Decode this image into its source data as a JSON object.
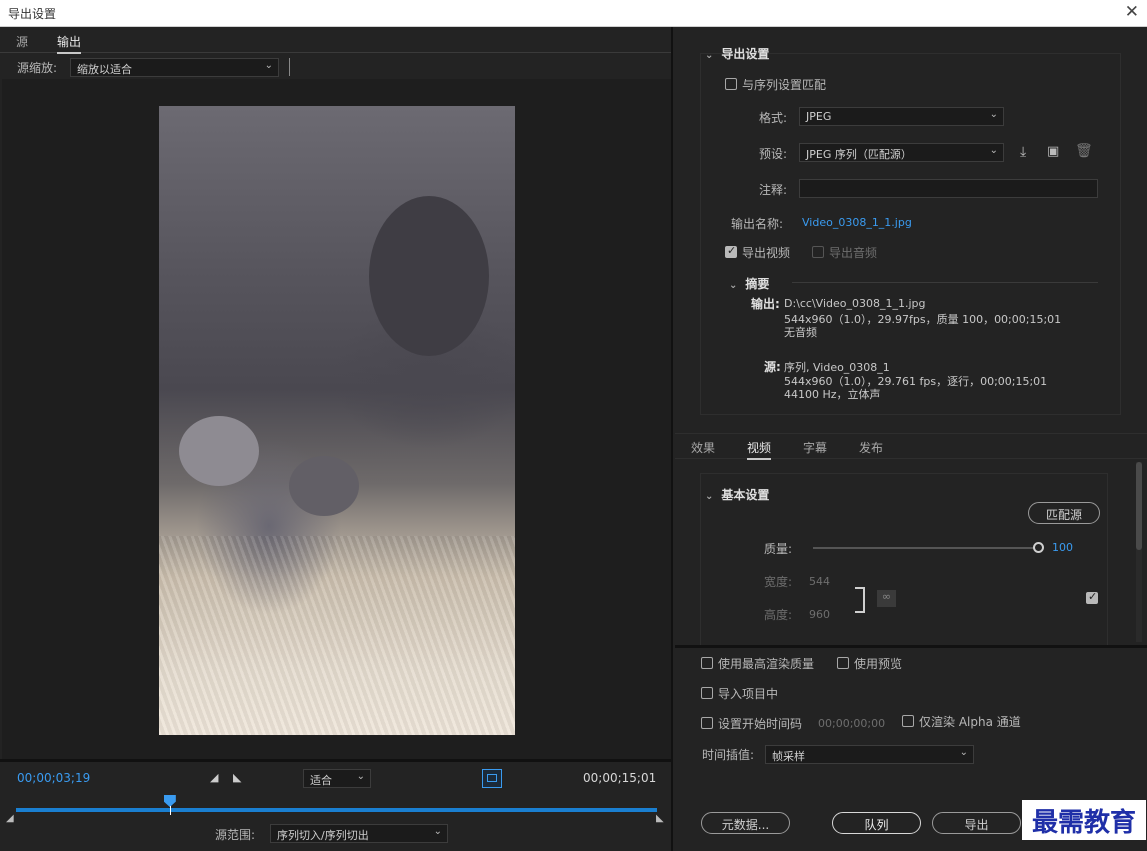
{
  "window": {
    "title": "导出设置",
    "close_glyph": "✕"
  },
  "left": {
    "tabs": [
      {
        "label": "源"
      },
      {
        "label": "输出"
      }
    ],
    "source_scale_label": "源缩放:",
    "source_scale_value": "缩放以适合",
    "timecode_current": "00;00;03;19",
    "timecode_end": "00;00;15;01",
    "fit_value": "适合",
    "source_range_label": "源范围:",
    "source_range_value": "序列切入/序列切出",
    "playhead_fraction": 0.24
  },
  "export": {
    "section_title": "导出设置",
    "match_sequence_label": "与序列设置匹配",
    "format_label": "格式:",
    "format_value": "JPEG",
    "preset_label": "预设:",
    "preset_value": "JPEG 序列（匹配源）",
    "comment_label": "注释:",
    "comment_value": "",
    "output_name_label": "输出名称:",
    "output_name_value": "Video_0308_1_1.jpg",
    "export_video_label": "导出视频",
    "export_audio_label": "导出音频"
  },
  "summary": {
    "title": "摘要",
    "output_label": "输出:",
    "output_line1": "D:\\cc\\Video_0308_1_1.jpg",
    "output_line2": "544x960（1.0），29.97fps，质量 100，00;00;15;01",
    "output_line3": "无音频",
    "source_label": "源:",
    "source_line1": "序列, Video_0308_1",
    "source_line2": "544x960（1.0），29.761 fps，逐行，00;00;15;01",
    "source_line3": "44100 Hz，立体声"
  },
  "settings_tabs": [
    {
      "label": "效果"
    },
    {
      "label": "视频"
    },
    {
      "label": "字幕"
    },
    {
      "label": "发布"
    }
  ],
  "basic": {
    "title": "基本设置",
    "match_source_button": "匹配源",
    "quality_label": "质量:",
    "quality_value": "100",
    "quality_fraction": 1.0,
    "width_label": "宽度:",
    "width_value": "544",
    "height_label": "高度:",
    "height_value": "960"
  },
  "bottom": {
    "max_render_label": "使用最高渲染质量",
    "use_preview_label": "使用预览",
    "import_label": "导入项目中",
    "set_timecode_label": "设置开始时间码",
    "set_timecode_value": "00;00;00;00",
    "alpha_label": "仅渲染 Alpha 通道",
    "interp_label": "时间插值:",
    "interp_value": "帧采样",
    "metadata_button": "元数据...",
    "queue_button": "队列",
    "export_button": "导出"
  },
  "watermark": "最需教育",
  "colors": {
    "accent": "#3a9bf0",
    "background": "#232323",
    "watermark": "#1f2fa8"
  }
}
